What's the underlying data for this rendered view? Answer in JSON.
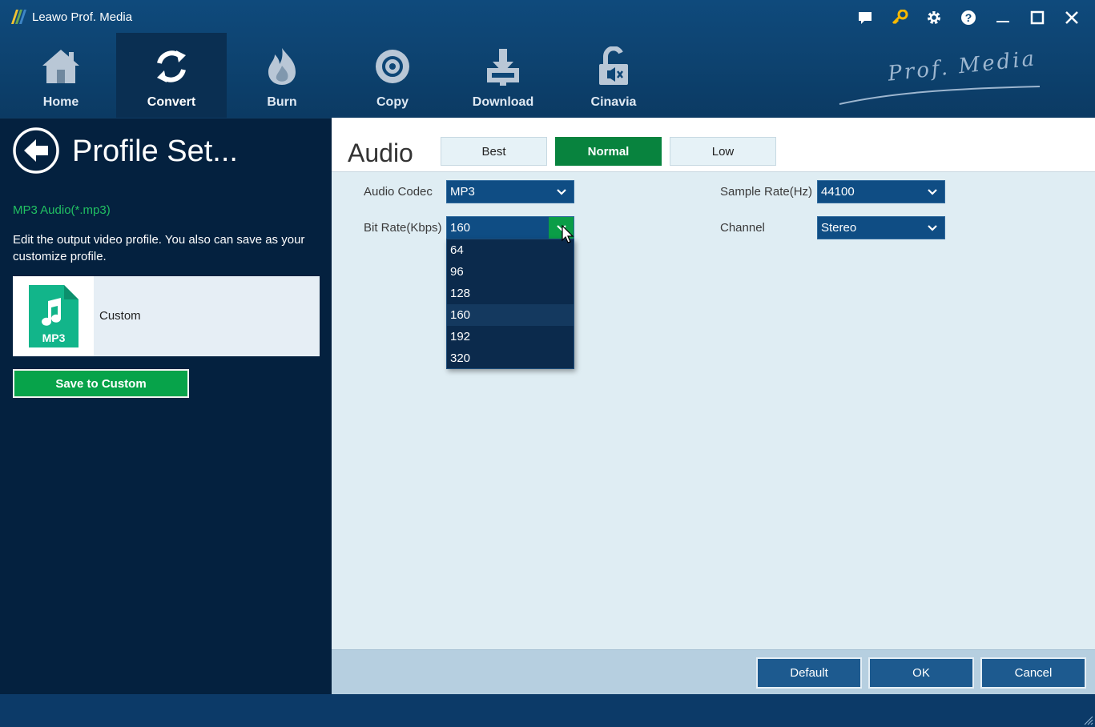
{
  "app": {
    "title": "Leawo Prof. Media",
    "brand": "Prof. Media"
  },
  "window_controls": [
    "chat-icon",
    "key-icon",
    "gear-icon",
    "help-icon",
    "minimize-icon",
    "maximize-icon",
    "close-icon"
  ],
  "nav": {
    "items": [
      {
        "label": "Home",
        "icon": "home-icon"
      },
      {
        "label": "Convert",
        "icon": "convert-icon",
        "active": true
      },
      {
        "label": "Burn",
        "icon": "burn-icon"
      },
      {
        "label": "Copy",
        "icon": "disc-icon"
      },
      {
        "label": "Download",
        "icon": "download-icon"
      },
      {
        "label": "Cinavia",
        "icon": "unlock-icon"
      }
    ]
  },
  "left": {
    "title": "Profile Set...",
    "format": "MP3 Audio(*.mp3)",
    "description": "Edit the output video profile. You also can save as your customize profile.",
    "card": {
      "thumb_label": "MP3",
      "name": "Custom"
    },
    "save_button": "Save to Custom"
  },
  "right": {
    "section": "Audio",
    "quality": {
      "options": [
        "Best",
        "Normal",
        "Low"
      ],
      "selected": "Normal"
    },
    "fields": {
      "audio_codec": {
        "label": "Audio Codec",
        "value": "MP3"
      },
      "bit_rate": {
        "label": "Bit Rate(Kbps)",
        "value": "160",
        "options": [
          "64",
          "96",
          "128",
          "160",
          "192",
          "320"
        ],
        "highlighted": "160"
      },
      "sample_rate": {
        "label": "Sample Rate(Hz)",
        "value": "44100"
      },
      "channel": {
        "label": "Channel",
        "value": "Stereo"
      }
    },
    "footer": {
      "default": "Default",
      "ok": "OK",
      "cancel": "Cancel"
    }
  },
  "colors": {
    "accent_green": "#08833e",
    "panel_dark": "#04213f",
    "header_blue": "#0f4a7c"
  }
}
